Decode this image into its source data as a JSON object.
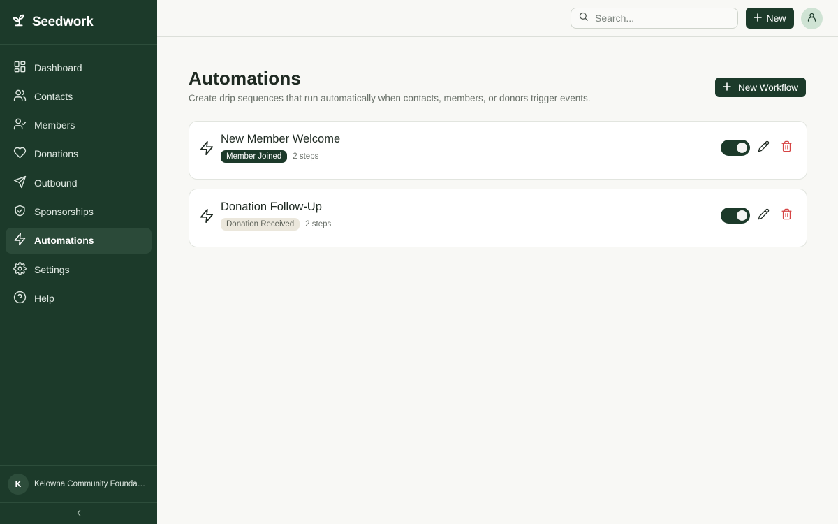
{
  "brand": {
    "name": "Seedwork",
    "icon": "sprout-icon"
  },
  "sidebar": {
    "items": [
      {
        "label": "Dashboard",
        "icon": "layout-icon",
        "active": false
      },
      {
        "label": "Contacts",
        "icon": "users-icon",
        "active": false
      },
      {
        "label": "Members",
        "icon": "user-check-icon",
        "active": false
      },
      {
        "label": "Donations",
        "icon": "heart-icon",
        "active": false
      },
      {
        "label": "Outbound",
        "icon": "send-icon",
        "active": false
      },
      {
        "label": "Sponsorships",
        "icon": "handshake-icon",
        "active": false
      },
      {
        "label": "Automations",
        "icon": "zap-icon",
        "active": true
      },
      {
        "label": "Settings",
        "icon": "gear-icon",
        "active": false
      },
      {
        "label": "Help",
        "icon": "help-icon",
        "active": false
      }
    ],
    "org": {
      "initial": "K",
      "name": "Kelowna Community Foundation"
    }
  },
  "topbar": {
    "search_placeholder": "Search...",
    "new_label": "New"
  },
  "page": {
    "title": "Automations",
    "subtitle": "Create drip sequences that run automatically when contacts, members, or donors trigger events.",
    "new_workflow_label": "New Workflow"
  },
  "workflows": [
    {
      "name": "New Member Welcome",
      "trigger": "Member Joined",
      "steps": "2 steps",
      "enabled": true
    },
    {
      "name": "Donation Follow-Up",
      "trigger": "Donation Received",
      "steps": "2 steps",
      "enabled": true
    }
  ],
  "colors": {
    "sidebar_bg": "#1c3a2a",
    "accent": "#1c3a2a",
    "delete": "#d64545",
    "page_bg": "#f8f8f5"
  }
}
